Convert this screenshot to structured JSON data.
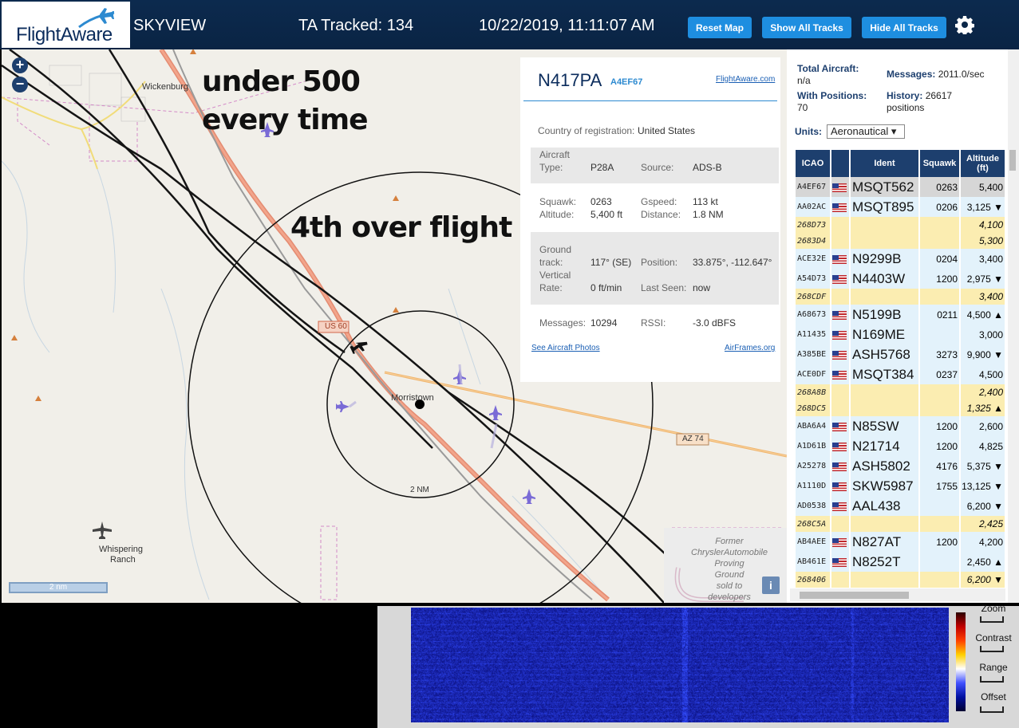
{
  "header": {
    "logo_text": "FlightAware",
    "app_name": "SKYVIEW",
    "tracked": "TA Tracked: 134",
    "datetime": "10/22/2019, 11:11:07 AM",
    "buttons": {
      "reset": "Reset Map",
      "show": "Show All Tracks",
      "hide": "Hide All Tracks"
    }
  },
  "map": {
    "zoom_in": "+",
    "zoom_out": "−",
    "annotations": {
      "a1": "under 500",
      "a2": "every time",
      "a3": "4th over flight"
    },
    "labels": {
      "wickenburg": "Wickenburg",
      "morristown": "Morristown",
      "us60": "US 60",
      "az74": "AZ 74",
      "nm2": "2 NM",
      "whisp1": "Whispering",
      "whisp2": "Ranch",
      "former": [
        "Former",
        "ChryslerAutomobile",
        "Proving",
        "Ground",
        "sold to",
        "developers"
      ]
    },
    "scale": "2 nm",
    "info": "i"
  },
  "detail": {
    "registration": "N417PA",
    "icao": "A4EF67",
    "fa_link": "FlightAware.com",
    "country_label": "Country of registration:",
    "country": "United States",
    "aircraft_type_label1": "Aircraft",
    "aircraft_type_label2": "Type:",
    "aircraft_type": "P28A",
    "source_label": "Source:",
    "source": "ADS-B",
    "squawk_label": "Squawk:",
    "squawk": "0263",
    "gspeed_label": "Gspeed:",
    "gspeed": "113 kt",
    "altitude_label": "Altitude:",
    "altitude": "5,400 ft",
    "distance_label": "Distance:",
    "distance": "1.8 NM",
    "ground_label1": "Ground",
    "ground_label2": "track:",
    "track": "117° (SE)",
    "position_label": "Position:",
    "position": "33.875°, -112.647°",
    "vert_label1": "Vertical",
    "vert_label2": "Rate:",
    "vert_rate": "0 ft/min",
    "last_seen_label": "Last Seen:",
    "last_seen": "now",
    "messages_label": "Messages:",
    "messages": "10294",
    "rssi_label": "RSSI:",
    "rssi": "-3.0 dBFS",
    "photos_link": "See Aircraft Photos",
    "airframes_link": "AirFrames.org"
  },
  "side": {
    "total_label": "Total Aircraft:",
    "total": "n/a",
    "messages_label": "Messages:",
    "messages": "2011.0/sec",
    "positions_label": "With Positions:",
    "positions": "70",
    "history_label": "History:",
    "history": "26617",
    "history_unit": "positions",
    "units_label": "Units:",
    "units_value": "Aeronautical ▾",
    "columns": {
      "icao": "ICAO",
      "ident": "Ident",
      "squawk": "Squawk",
      "altitude1": "Altitude",
      "altitude2": "(ft)"
    }
  },
  "aircraft": [
    {
      "kind": "sel",
      "icao": "A4EF67",
      "ident": "MSQT562",
      "squawk": "0263",
      "alt": "5,400"
    },
    {
      "kind": "ads",
      "icao": "AA02AC",
      "ident": "MSQT895",
      "squawk": "0206",
      "alt": "3,125 ▼"
    },
    {
      "kind": "mlat",
      "icao": "268D73",
      "ident": "",
      "squawk": "",
      "alt": "4,100"
    },
    {
      "kind": "mlat",
      "icao": "2683D4",
      "ident": "",
      "squawk": "",
      "alt": "5,300"
    },
    {
      "kind": "ads",
      "icao": "ACE32E",
      "ident": "N9299B",
      "squawk": "0204",
      "alt": "3,400"
    },
    {
      "kind": "ads",
      "icao": "A54D73",
      "ident": "N4403W",
      "squawk": "1200",
      "alt": "2,975 ▼"
    },
    {
      "kind": "mlat",
      "icao": "268CDF",
      "ident": "",
      "squawk": "",
      "alt": "3,400"
    },
    {
      "kind": "ads",
      "icao": "A68673",
      "ident": "N5199B",
      "squawk": "0211",
      "alt": "4,500 ▲"
    },
    {
      "kind": "ads",
      "icao": "A11435",
      "ident": "N169ME",
      "squawk": "",
      "alt": "3,000"
    },
    {
      "kind": "ads",
      "icao": "A385BE",
      "ident": "ASH5768",
      "squawk": "3273",
      "alt": "9,900 ▼"
    },
    {
      "kind": "ads",
      "icao": "ACE0DF",
      "ident": "MSQT384",
      "squawk": "0237",
      "alt": "4,500"
    },
    {
      "kind": "mlat",
      "icao": "268A8B",
      "ident": "",
      "squawk": "",
      "alt": "2,400"
    },
    {
      "kind": "mlat",
      "icao": "268DC5",
      "ident": "",
      "squawk": "",
      "alt": "1,325 ▲"
    },
    {
      "kind": "ads",
      "icao": "ABA6A4",
      "ident": "N85SW",
      "squawk": "1200",
      "alt": "2,600"
    },
    {
      "kind": "ads",
      "icao": "A1D61B",
      "ident": "N21714",
      "squawk": "1200",
      "alt": "4,825"
    },
    {
      "kind": "ads",
      "icao": "A25278",
      "ident": "ASH5802",
      "squawk": "4176",
      "alt": "5,375 ▼"
    },
    {
      "kind": "ads",
      "icao": "A1110D",
      "ident": "SKW5987",
      "squawk": "1755",
      "alt": "13,125 ▼"
    },
    {
      "kind": "ads",
      "icao": "AD0538",
      "ident": "AAL438",
      "squawk": "",
      "alt": "6,200 ▼"
    },
    {
      "kind": "mlat",
      "icao": "268C5A",
      "ident": "",
      "squawk": "",
      "alt": "2,425"
    },
    {
      "kind": "ads",
      "icao": "AB4AEE",
      "ident": "N827AT",
      "squawk": "1200",
      "alt": "4,200"
    },
    {
      "kind": "ads",
      "icao": "AB461E",
      "ident": "N8252T",
      "squawk": "",
      "alt": "2,450 ▲"
    },
    {
      "kind": "mlat",
      "icao": "268406",
      "ident": "",
      "squawk": "",
      "alt": "6,200 ▼"
    }
  ],
  "waterfall": {
    "zoom": "Zoom",
    "contrast": "Contrast",
    "range": "Range",
    "offset": "Offset"
  }
}
